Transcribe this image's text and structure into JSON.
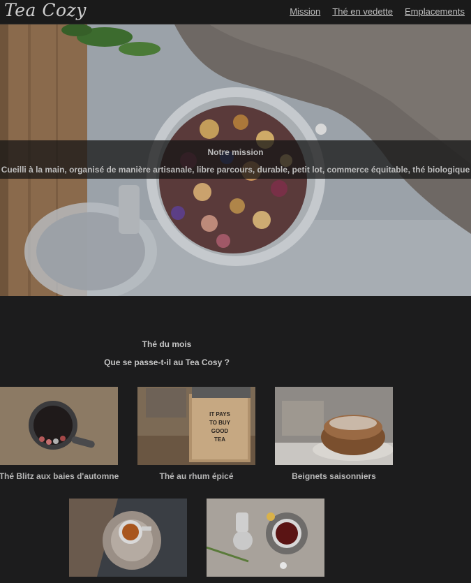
{
  "header": {
    "logo_text": "Tea Cozy",
    "nav": [
      {
        "label": "Mission"
      },
      {
        "label": "Thé en vedette"
      },
      {
        "label": "Emplacements"
      }
    ]
  },
  "hero": {
    "mission_title": "Notre mission",
    "mission_text": "Cueilli à la main, organisé de manière artisanale, libre parcours, durable, petit lot, commerce équitable, thé biologique"
  },
  "featured": {
    "title": "Thé du mois",
    "subtitle": "Que se passe-t-il au Tea Cosy ?",
    "items": [
      {
        "caption": "Thé Blitz aux baies d'automne"
      },
      {
        "caption": "Thé au rhum épicé"
      },
      {
        "caption": "Beignets saisonniers"
      },
      {
        "caption": ""
      },
      {
        "caption": ""
      }
    ],
    "box_text": "IT PAYS TO BUY GOOD TEA"
  }
}
